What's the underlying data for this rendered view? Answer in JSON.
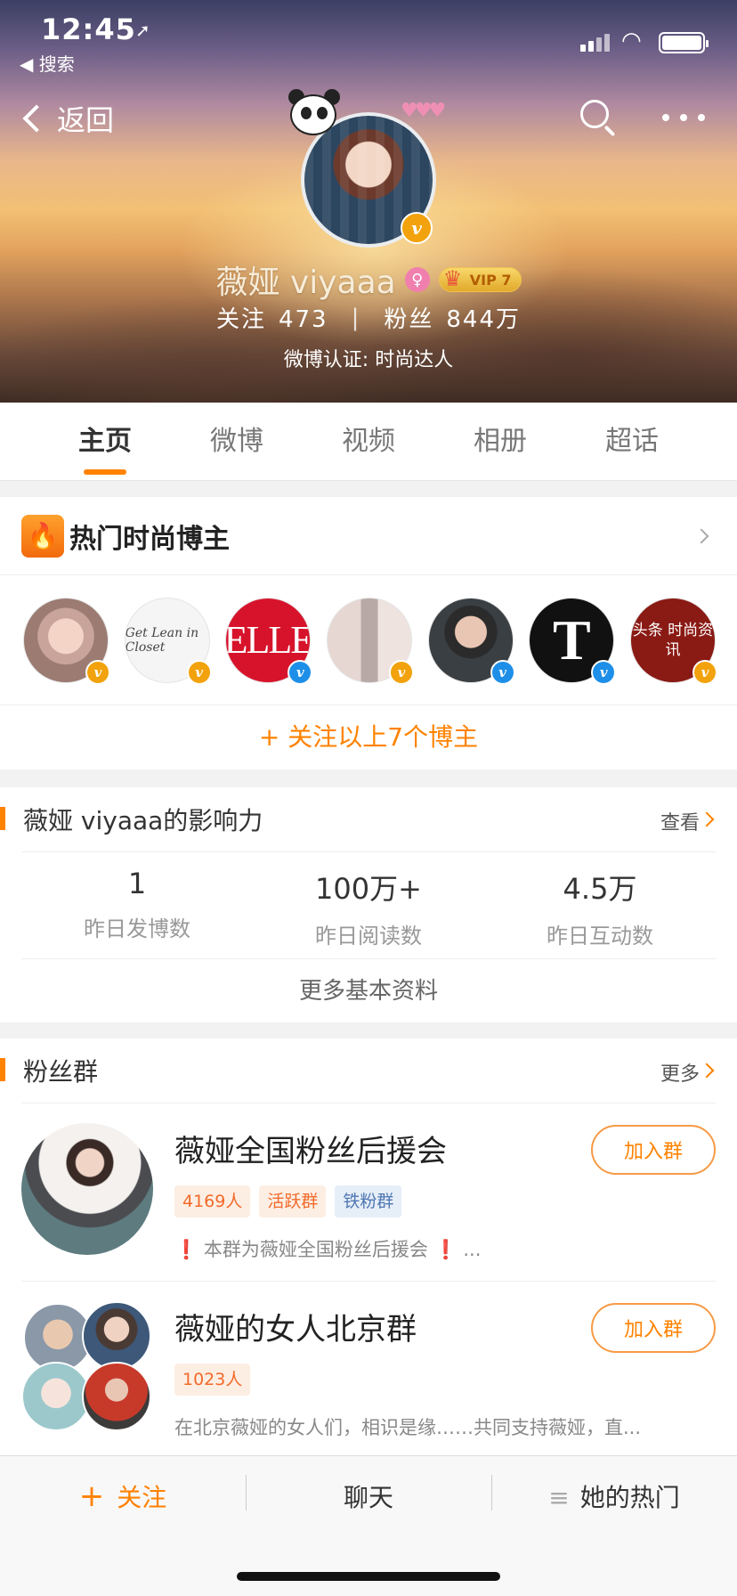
{
  "status_bar": {
    "time": "12:45",
    "location_glyph": "➚",
    "back_app": "◀ 搜索"
  },
  "nav": {
    "back_label": "返回"
  },
  "profile": {
    "name": "薇娅 viyaa",
    "name_suffix": "a",
    "gender_symbol": "♀",
    "vip_label": "VIP 7",
    "following_label": "关注",
    "following_count": "473",
    "followers_label": "粉丝",
    "followers_count": "844万",
    "verification": "微博认证: 时尚达人"
  },
  "tabs": [
    {
      "label": "主页",
      "active": true
    },
    {
      "label": "微博",
      "active": false
    },
    {
      "label": "视频",
      "active": false
    },
    {
      "label": "相册",
      "active": false
    },
    {
      "label": "超话",
      "active": false
    }
  ],
  "hot_bloggers": {
    "title": "热门时尚博主",
    "icon": "fire-icon",
    "items": [
      {
        "badge": "gold",
        "text": ""
      },
      {
        "badge": "gold",
        "text": "Get Lean in Closet"
      },
      {
        "badge": "blue",
        "text": "ELLE"
      },
      {
        "badge": "gold",
        "text": ""
      },
      {
        "badge": "blue",
        "text": ""
      },
      {
        "badge": "blue",
        "text": "T"
      },
      {
        "badge": "gold",
        "text": "头条 时尚资讯"
      }
    ],
    "follow_all": "+ 关注以上7个博主"
  },
  "influence": {
    "title": "薇娅 viyaaa的影响力",
    "link": "查看",
    "stats": [
      {
        "value": "1",
        "label": "昨日发博数"
      },
      {
        "value": "100万+",
        "label": "昨日阅读数"
      },
      {
        "value": "4.5万",
        "label": "昨日互动数"
      }
    ],
    "more": "更多基本资料"
  },
  "fan_groups": {
    "title": "粉丝群",
    "link": "更多",
    "groups": [
      {
        "name": "薇娅全国粉丝后援会",
        "join": "加入群",
        "tags": [
          {
            "text": "4169人",
            "style": "orange"
          },
          {
            "text": "活跃群",
            "style": "orange"
          },
          {
            "text": "铁粉群",
            "style": "blue"
          }
        ],
        "desc_mark": "❗",
        "desc": "本群为薇娅全国粉丝后援会",
        "desc_tail": "..."
      },
      {
        "name": "薇娅的女人北京群",
        "join": "加入群",
        "tags": [
          {
            "text": "1023人",
            "style": "orange"
          }
        ],
        "desc": "在北京薇娅的女人们，相识是缘……共同支持薇娅，直..."
      }
    ]
  },
  "bottom_bar": {
    "follow": "关注",
    "chat": "聊天",
    "her_hot": "她的热门"
  },
  "colors": {
    "accent": "#ff8200",
    "verified_gold": "#f2a20c",
    "verified_blue": "#1e8fe8"
  }
}
